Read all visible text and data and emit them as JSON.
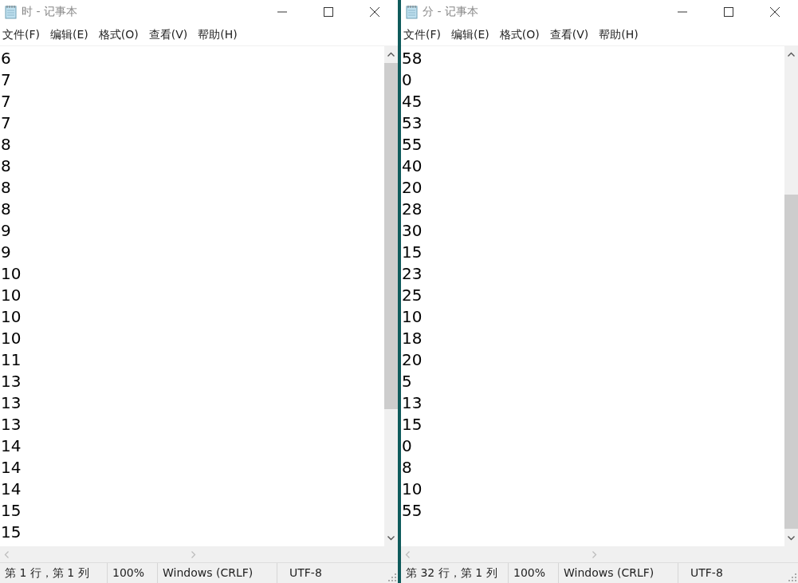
{
  "windows": [
    {
      "title": "时 - 记事本",
      "menu": [
        "文件(F)",
        "编辑(E)",
        "格式(O)",
        "查看(V)",
        "帮助(H)"
      ],
      "lines": [
        "6",
        "7",
        "7",
        "7",
        "8",
        "8",
        "8",
        "8",
        "9",
        "9",
        "10",
        "10",
        "10",
        "10",
        "11",
        "13",
        "13",
        "13",
        "14",
        "14",
        "14",
        "15",
        "15"
      ],
      "status": {
        "position": "第 1 行，第 1 列",
        "zoom": "100%",
        "line_ending": "Windows (CRLF)",
        "encoding": "UTF-8"
      }
    },
    {
      "title": "分 - 记事本",
      "menu": [
        "文件(F)",
        "编辑(E)",
        "格式(O)",
        "查看(V)",
        "帮助(H)"
      ],
      "lines": [
        "58",
        "0",
        "45",
        "53",
        "55",
        "40",
        "20",
        "28",
        "30",
        "15",
        "23",
        "25",
        "10",
        "18",
        "20",
        "5",
        "13",
        "15",
        "0",
        "8",
        "10",
        "55"
      ],
      "status": {
        "position": "第 32 行，第 1 列",
        "zoom": "100%",
        "line_ending": "Windows (CRLF)",
        "encoding": "UTF-8"
      }
    }
  ]
}
